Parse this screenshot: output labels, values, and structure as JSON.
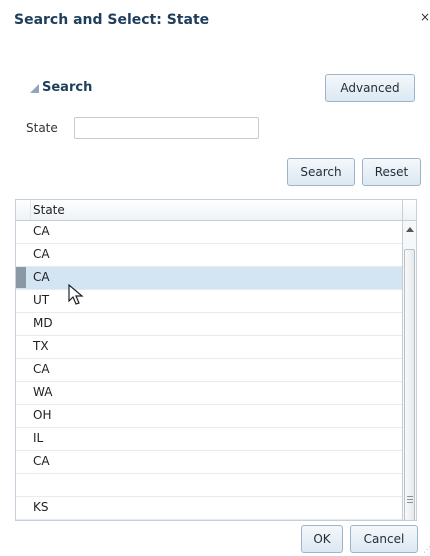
{
  "dialog": {
    "title": "Search and Select: State",
    "close_label": "×"
  },
  "search": {
    "header": "Search",
    "advanced_label": "Advanced",
    "field_label": "State",
    "field_value": "",
    "search_label": "Search",
    "reset_label": "Reset"
  },
  "table": {
    "column_header": "State",
    "rows": [
      "CA",
      "CA",
      "CA",
      "UT",
      "MD",
      "TX",
      "CA",
      "WA",
      "OH",
      "IL",
      "CA",
      "",
      "KS"
    ],
    "selected_index": 2
  },
  "footer": {
    "ok_label": "OK",
    "cancel_label": "Cancel"
  },
  "icons": [
    "close-icon",
    "collapse-triangle-icon",
    "scroll-up-arrow-icon",
    "mouse-pointer-icon",
    "resize-grip-icon"
  ]
}
